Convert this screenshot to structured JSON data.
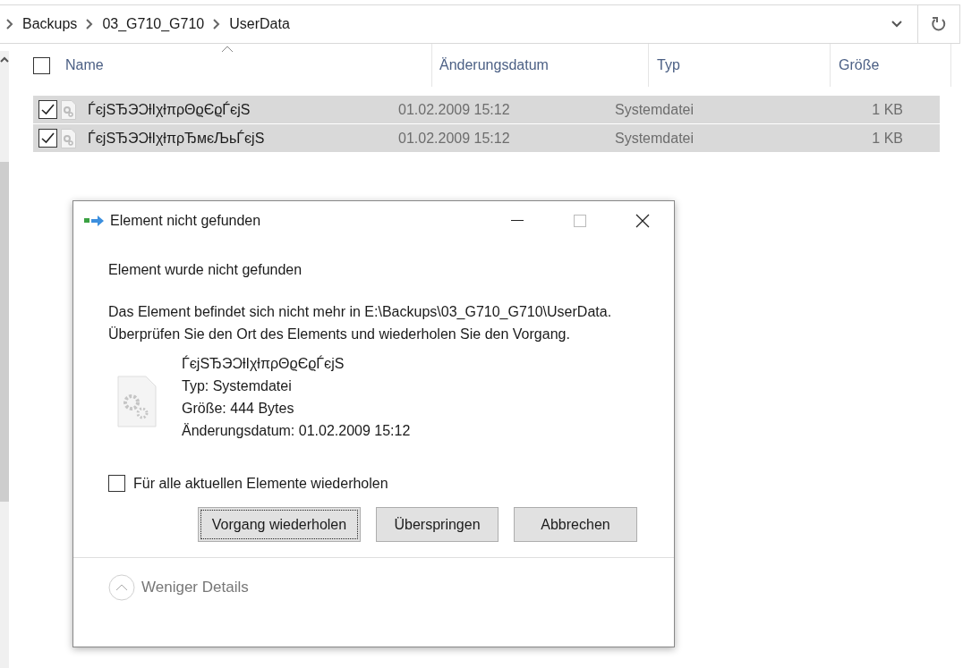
{
  "address_bar": {
    "crumbs": [
      "Backups",
      "03_G710_G710",
      "UserData"
    ]
  },
  "file_list": {
    "select_all": {
      "checked": false
    },
    "columns": [
      "Name",
      "Änderungsdatum",
      "Typ",
      "Größe"
    ],
    "rows": [
      {
        "name": "ЃєјЅЂЭƆƚІχƚπρΘϱЄϱЃєјЅ",
        "date": "01.02.2009 15:12",
        "type": "Systemdatei",
        "size": "1 KB",
        "selected": true,
        "checked": true
      },
      {
        "name": "ЃєјЅЂЭƆƚІχƚπρЂмєЉьЃєјЅ",
        "date": "01.02.2009 15:12",
        "type": "Systemdatei",
        "size": "1 KB",
        "selected": true,
        "checked": true
      }
    ]
  },
  "dialog": {
    "title": "Element nicht gefunden",
    "heading": "Element wurde nicht gefunden",
    "message": "Das Element befindet sich nicht mehr in E:\\Backups\\03_G710_G710\\UserData. Überprüfen Sie den Ort des Elements und wiederholen Sie den Vorgang.",
    "file": {
      "name": "ЃєјЅЂЭƆƚІχƚπρΘϱЄϱЃєјЅ",
      "details": [
        "Typ: Systemdatei",
        "Größe: 444 Bytes",
        "Änderungsdatum: 01.02.2009 15:12"
      ]
    },
    "repeat_for_all": {
      "label": "Für alle aktuellen Elemente wiederholen",
      "checked": false
    },
    "buttons": [
      {
        "label": "Vorgang wiederholen",
        "focused": true
      },
      {
        "label": "Überspringen",
        "focused": false
      },
      {
        "label": "Abbrechen",
        "focused": false
      }
    ],
    "details_toggle": "Weniger Details"
  }
}
